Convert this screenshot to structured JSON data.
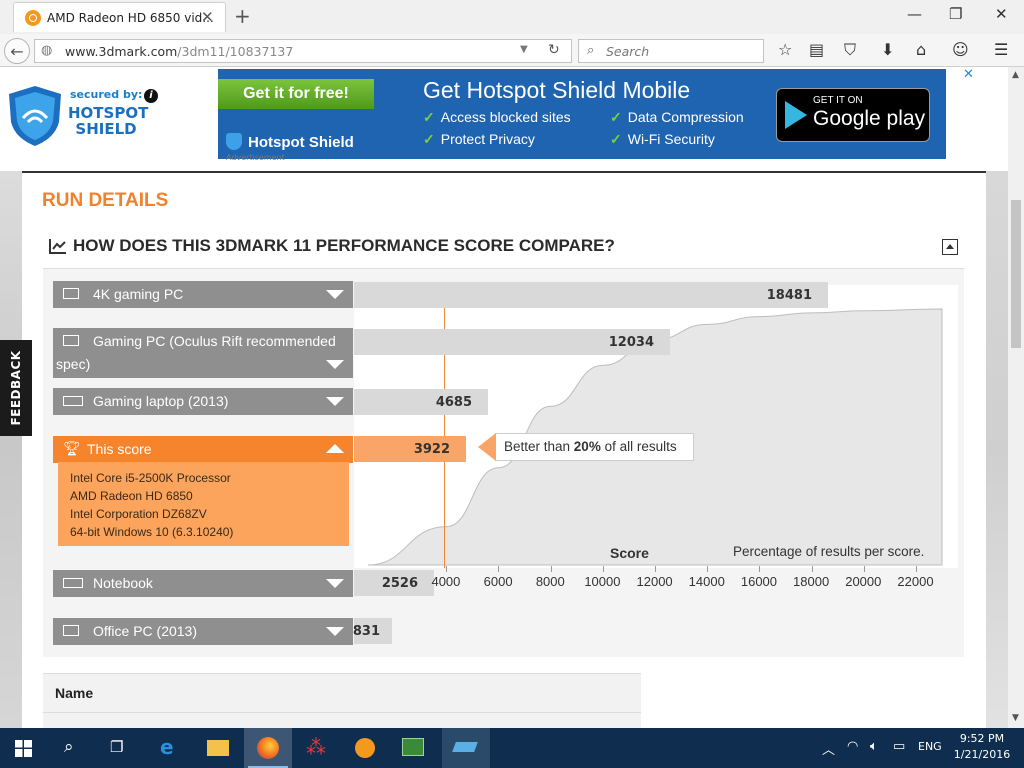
{
  "browser": {
    "tab_title": "AMD Radeon HD 6850 vid...",
    "url_host": "www.3dmark.com",
    "url_path": "/3dm11/10837137",
    "search_placeholder": "Search"
  },
  "ad": {
    "secured_by": "secured by:",
    "brand_line1": "HOTSPOT",
    "brand_line2": "SHIELD",
    "get_free": "Get it for free!",
    "headline": "Get Hotspot Shield Mobile",
    "features": [
      "Access blocked sites",
      "Data Compression",
      "Protect Privacy",
      "Wi-Fi Security"
    ],
    "brand_bottom": "Hotspot Shield",
    "play_small": "GET IT ON",
    "play_big": "Google play",
    "label": "Advertisement"
  },
  "page": {
    "run_details": "RUN DETAILS",
    "section_title": "HOW DOES THIS 3DMARK 11 PERFORMANCE SCORE COMPARE?",
    "feedback": "FEEDBACK",
    "name_header": "Name"
  },
  "rows": [
    {
      "label": "4K gaming PC",
      "score": "18481"
    },
    {
      "label": "Gaming PC (Oculus Rift recommended",
      "label2": "spec)",
      "score": "12034"
    },
    {
      "label": "Gaming laptop (2013)",
      "score": "4685"
    },
    {
      "label": "This score",
      "score": "3922"
    },
    {
      "label": "Notebook",
      "score": "2526"
    },
    {
      "label": "Office PC (2013)",
      "score": "831"
    }
  ],
  "this_details": [
    "Intel Core i5-2500K Processor",
    "AMD Radeon HD 6850",
    "Intel Corporation DZ68ZV",
    "64-bit Windows 10 (6.3.10240)"
  ],
  "callout": {
    "prefix": "Better than ",
    "pct": "20%",
    "suffix": " of all results"
  },
  "chart_data": {
    "type": "area",
    "xlabel": "Score",
    "ylabel": "Percentage of results per score.",
    "x_ticks": [
      "4000",
      "6000",
      "8000",
      "10000",
      "12000",
      "14000",
      "16000",
      "18000",
      "20000",
      "22000"
    ],
    "xlim": [
      1000,
      23000
    ],
    "marker_score": 3922,
    "curve_points": [
      [
        1000,
        0
      ],
      [
        4000,
        15
      ],
      [
        6000,
        38
      ],
      [
        8000,
        62
      ],
      [
        10000,
        78
      ],
      [
        12000,
        88
      ],
      [
        14000,
        94
      ],
      [
        16000,
        97
      ],
      [
        18000,
        98.5
      ],
      [
        20000,
        99.3
      ],
      [
        23000,
        100
      ]
    ]
  },
  "taskbar": {
    "time": "9:52 PM",
    "date": "1/21/2016",
    "lang": "ENG"
  },
  "colors": {
    "accent": "#f5842c",
    "bar": "#d9d9d9",
    "row": "#8f8f8f",
    "taskbar": "#0f2d4e"
  }
}
